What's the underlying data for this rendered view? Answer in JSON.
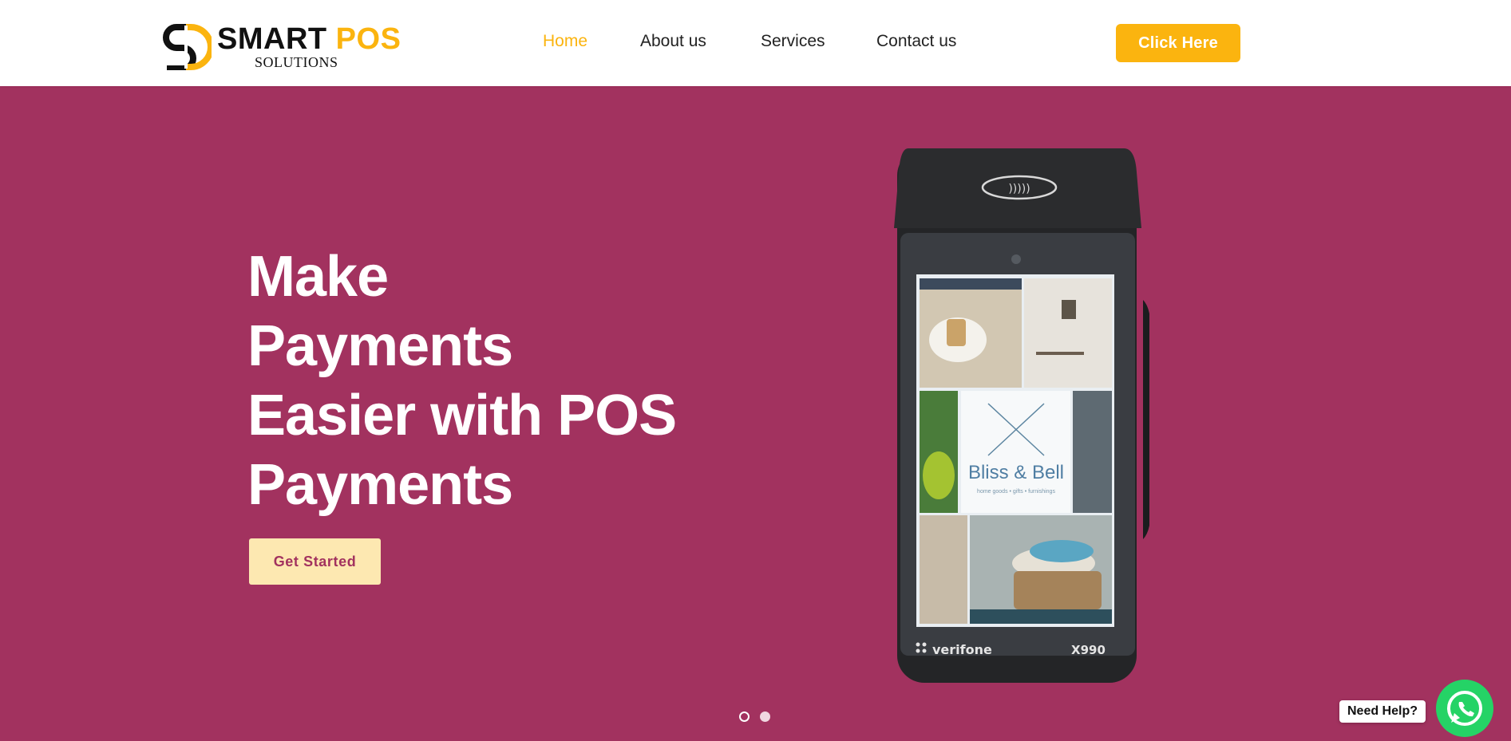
{
  "header": {
    "logo": {
      "smart": "SMART",
      "pos": "POS",
      "sub": "SOLUTIONS"
    },
    "nav": [
      {
        "label": "Home",
        "active": true
      },
      {
        "label": "About us",
        "active": false
      },
      {
        "label": "Services",
        "active": false
      },
      {
        "label": "Contact us",
        "active": false
      }
    ],
    "cta_label": "Click Here"
  },
  "hero": {
    "title_lines": [
      "Make",
      "Payments",
      "Easier with POS",
      "Payments"
    ],
    "button_label": "Get Started",
    "device": {
      "brand": "verifone",
      "model": "X990",
      "screen_text": "Bliss & Bell",
      "screen_subtext": "home goods • gifts • furnishings"
    }
  },
  "carousel": {
    "slides": 2,
    "active_index": 1
  },
  "help": {
    "label": "Need Help?"
  },
  "colors": {
    "brand_accent": "#fbb40f",
    "hero_bg": "#a2325f",
    "button_light": "#fde8b1",
    "whatsapp": "#25d366"
  }
}
